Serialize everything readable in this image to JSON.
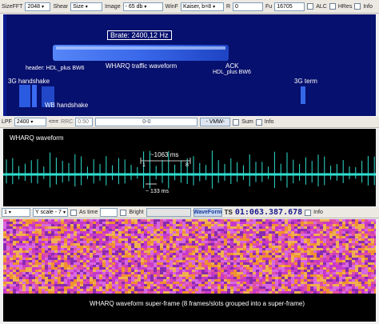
{
  "toolbar1": {
    "sizefft_label": "SizeFFT",
    "sizefft_value": "2048",
    "shear_label": "Shear",
    "shear_value": "Size",
    "image_label": "Image",
    "image_value": "- 65 db",
    "winf_label": "WinF",
    "winf_value": "Kaiser, b=8",
    "r_label": "R",
    "r_value": "0",
    "fu_label": "Fu",
    "fu_value": "16705",
    "alc_label": "ALC",
    "hres_label": "HRes",
    "info_label": "Info"
  },
  "spectrogram": {
    "brate": "Brate: 2400,12 Hz",
    "header_note": "header: HDL_plus BW6",
    "traffic": "WHARQ traffic waveform",
    "ack": "ACK",
    "ack_note": "HDL_plus BW6",
    "hs3g": "3G handshake",
    "wb_hs": "WB handshake",
    "term3g": "3G term"
  },
  "toolbar2": {
    "lpf_label": "LPF",
    "lpf_value": "2400",
    "arrow": "<==",
    "rrc_label": "RRC",
    "rrc_value": "0.50",
    "range_value": "0-0",
    "vmw_label": "- VMW-",
    "sum_label": "Sum",
    "info_label": "Info"
  },
  "waveform": {
    "title": "WHARQ waveform",
    "span_label": "~1063 ms",
    "marker1": "1",
    "marker8": "8",
    "small_span": "~ 133 ms"
  },
  "toolbar3": {
    "num_value": "1",
    "yscale_value": "Y scale - 7",
    "astime_label": "As time",
    "bright_label": "Bright",
    "waveform_button": "WaveForm",
    "ts_label": "TS",
    "ts_value": "01:063.387.678",
    "info_label": "Info"
  },
  "superframe": {
    "caption": "WHARQ waveform super-frame (8 frames/slots grouped into a super-frame)"
  },
  "colors": {
    "spec_bg": "#06106e",
    "wave_bg": "#000000",
    "wave_line": "#2fe0d0",
    "sf_magenta": "#c838c8",
    "sf_orange": "#f09030"
  }
}
